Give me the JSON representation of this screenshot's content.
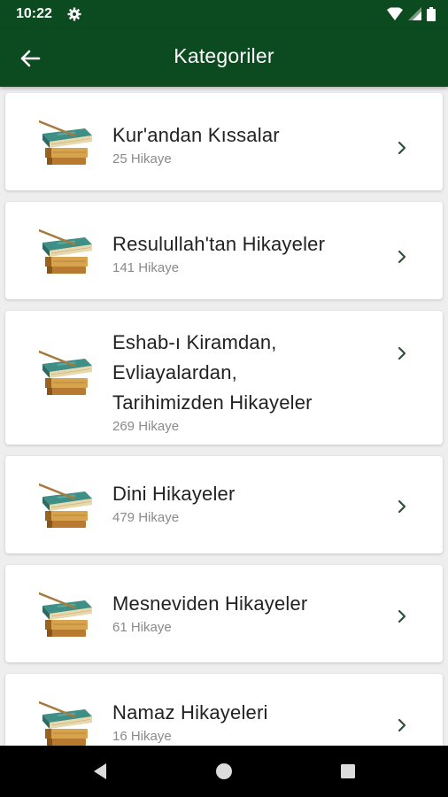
{
  "status": {
    "time": "10:22"
  },
  "appbar": {
    "title": "Kategoriler"
  },
  "categories": [
    {
      "title": "Kur'andan Kıssalar",
      "count": "25 Hikaye"
    },
    {
      "title": "Resulullah'tan Hikayeler",
      "count": "141 Hikaye"
    },
    {
      "title_lines": [
        "Eshab-ı Kiramdan,",
        "Evliayalardan,",
        "Tarihimizden Hikayeler"
      ],
      "count": "269 Hikaye"
    },
    {
      "title": "Dini Hikayeler",
      "count": "479 Hikaye"
    },
    {
      "title": "Mesneviden Hikayeler",
      "count": "61 Hikaye"
    },
    {
      "title": "Namaz Hikayeleri",
      "count": "16 Hikaye"
    }
  ],
  "icons": {
    "status": [
      "settings-icon",
      "wifi-icon",
      "signal-icon",
      "battery-icon"
    ],
    "appbar": "arrow-back-icon",
    "item": "books-icon",
    "item_action": "chevron-right-icon",
    "nav": [
      "nav-back-icon",
      "nav-home-icon",
      "nav-recents-icon"
    ]
  },
  "colors": {
    "primary": "#0c4a1f",
    "background": "#eeeeee",
    "card": "#ffffff",
    "subtitle": "#8a8a8a"
  }
}
